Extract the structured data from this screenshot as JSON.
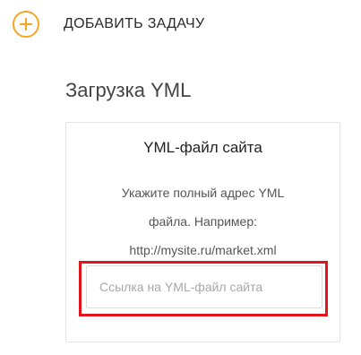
{
  "header": {
    "add_task_label": "ДОБАВИТЬ ЗАДАЧУ",
    "add_icon": "plus-circle-icon",
    "accent_color": "#f5a623"
  },
  "section": {
    "title": "Загрузка YML"
  },
  "card": {
    "title": "YML-файл сайта",
    "desc_line1": "Укажите полный адрес YML",
    "desc_line2": "файла. Например:",
    "desc_line3": "http://mysite.ru/market.xml",
    "input": {
      "value": "",
      "placeholder": "Ссылка на YML-файл сайта"
    },
    "highlight_color": "#e3141b"
  }
}
